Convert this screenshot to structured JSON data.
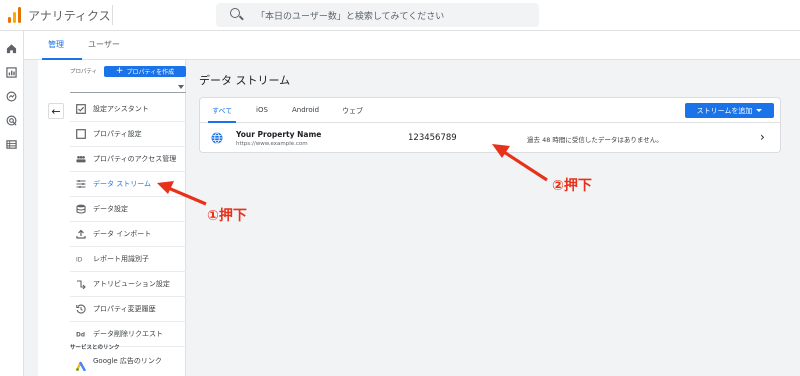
{
  "app": {
    "title": "アナリティクス"
  },
  "search": {
    "placeholder": "「本日のユーザー数」と検索してみてください"
  },
  "tabs": [
    {
      "label": "管理",
      "active": true
    },
    {
      "label": "ユーザー",
      "active": false
    }
  ],
  "property": {
    "label": "プロパティ",
    "create_button": "プロパティを作成"
  },
  "menu": {
    "items": [
      {
        "label": "設定アシスタント",
        "icon": "checkbox-icon"
      },
      {
        "label": "プロパティ設定",
        "icon": "square-icon"
      },
      {
        "label": "プロパティのアクセス管理",
        "icon": "people-icon"
      },
      {
        "label": "データ ストリーム",
        "icon": "streams-icon",
        "active": true
      },
      {
        "label": "データ設定",
        "icon": "database-icon"
      },
      {
        "label": "データ インポート",
        "icon": "upload-icon"
      },
      {
        "label": "レポート用識別子",
        "icon": "identity-icon"
      },
      {
        "label": "アトリビューション設定",
        "icon": "attribution-icon"
      },
      {
        "label": "プロパティ変更履歴",
        "icon": "history-icon"
      },
      {
        "label": "データ削除リクエスト",
        "icon": "dd-icon"
      }
    ],
    "section_label": "サービスとのリンク",
    "google_ads": "Google 広告のリンク"
  },
  "content": {
    "title": "データ ストリーム",
    "subtabs": [
      {
        "label": "すべて",
        "active": true
      },
      {
        "label": "iOS"
      },
      {
        "label": "Android"
      },
      {
        "label": "ウェブ"
      }
    ],
    "add_stream": "ストリームを追加",
    "stream": {
      "name": "Your Property Name",
      "url": "https://www.example.com",
      "id": "123456789",
      "status": "過去 48 時間に受信したデータはありません。"
    }
  },
  "annotations": {
    "step1": "①押下",
    "step2": "②押下"
  },
  "colors": {
    "accent": "#1a73e8",
    "annotation": "#e8311a"
  }
}
